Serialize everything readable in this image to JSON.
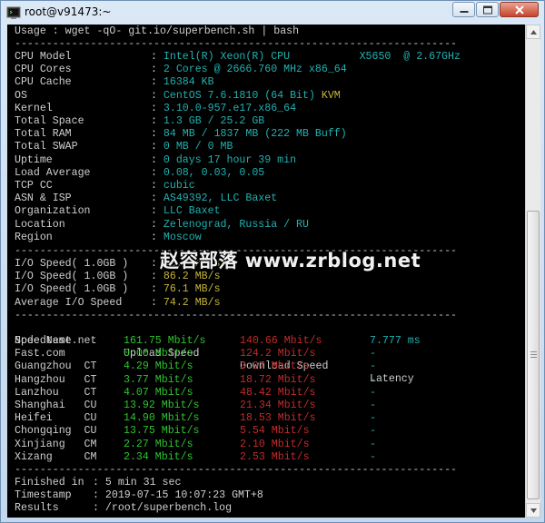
{
  "window": {
    "title": "root@v91473:~"
  },
  "usage_line": "Usage : wget -qO- git.io/superbench.sh | bash",
  "separator": "----------------------------------------------------------------------",
  "system": [
    {
      "label": "CPU Model",
      "value": "Intel(R) Xeon(R) CPU           X5650  @ 2.67GHz"
    },
    {
      "label": "CPU Cores",
      "value": "2 Cores @ 2666.760 MHz x86_64"
    },
    {
      "label": "CPU Cache",
      "value": "16384 KB"
    },
    {
      "label": "OS",
      "value": "CentOS 7.6.1810 (64 Bit)",
      "extra": "KVM"
    },
    {
      "label": "Kernel",
      "value": "3.10.0-957.e17.x86_64"
    },
    {
      "label": "Total Space",
      "value": "1.3 GB / 25.2 GB"
    },
    {
      "label": "Total RAM",
      "value": "84 MB / 1837 MB (222 MB Buff)"
    },
    {
      "label": "Total SWAP",
      "value": "0 MB / 0 MB"
    },
    {
      "label": "Uptime",
      "value": "0 days 17 hour 39 min"
    },
    {
      "label": "Load Average",
      "value": "0.08, 0.03, 0.05"
    },
    {
      "label": "TCP CC",
      "value": "cubic"
    },
    {
      "label": "ASN & ISP",
      "value": "AS49392, LLC Baxet"
    },
    {
      "label": "Organization",
      "value": "LLC Baxet"
    },
    {
      "label": "Location",
      "value": "Zelenograd, Russia / RU"
    },
    {
      "label": "Region",
      "value": "Moscow"
    }
  ],
  "io": [
    {
      "label": "I/O Speed( 1.0GB )",
      "value": "93.7 MB/s"
    },
    {
      "label": "I/O Speed( 1.0GB )",
      "value": "86.2 MB/s"
    },
    {
      "label": "I/O Speed( 1.0GB )",
      "value": "76.1 MB/s"
    },
    {
      "label": "Average I/O Speed",
      "value": "74.2 MB/s"
    }
  ],
  "speedtest": {
    "headers": [
      "Node Name",
      "Upload Speed",
      "Download Speed",
      "Latency"
    ],
    "rows": [
      {
        "node": "Speedtest.net",
        "up": "161.75 Mbit/s",
        "down": "140.66 Mbit/s",
        "lat": "7.777 ms"
      },
      {
        "node": "Fast.com",
        "up": "0.00 Mbit/s",
        "down": "124.2 Mbit/s",
        "lat": "-"
      },
      {
        "node": "Guangzhou  CT",
        "up": "4.29 Mbit/s",
        "down": "3.97 Mbit/s",
        "lat": "-"
      },
      {
        "node": "Hangzhou   CT",
        "up": "3.77 Mbit/s",
        "down": "18.72 Mbit/s",
        "lat": "-"
      },
      {
        "node": "Lanzhou    CT",
        "up": "4.07 Mbit/s",
        "down": "48.42 Mbit/s",
        "lat": "-"
      },
      {
        "node": "Shanghai   CU",
        "up": "13.92 Mbit/s",
        "down": "21.34 Mbit/s",
        "lat": "-"
      },
      {
        "node": "Heifei     CU",
        "up": "14.90 Mbit/s",
        "down": "18.53 Mbit/s",
        "lat": "-"
      },
      {
        "node": "Chongqing  CU",
        "up": "13.75 Mbit/s",
        "down": "5.54 Mbit/s",
        "lat": "-"
      },
      {
        "node": "Xinjiang   CM",
        "up": "2.27 Mbit/s",
        "down": "2.10 Mbit/s",
        "lat": "-"
      },
      {
        "node": "Xizang     CM",
        "up": "2.34 Mbit/s",
        "down": "2.53 Mbit/s",
        "lat": "-"
      }
    ]
  },
  "footer": [
    {
      "label": "Finished in",
      "value": "5 min 31 sec"
    },
    {
      "label": "Timestamp",
      "value": "2019-07-15 10:07:23 GMT+8"
    },
    {
      "label": "Results",
      "value": "/root/superbench.log"
    }
  ],
  "watermark": "赵容部落 www.zrblog.net",
  "colors": {
    "label": "#cfcfcf",
    "value_cyan": "#22b0b0",
    "value_yellow": "#c6b53a",
    "upload_green": "#2ec32e",
    "download_red": "#c42a2a"
  }
}
